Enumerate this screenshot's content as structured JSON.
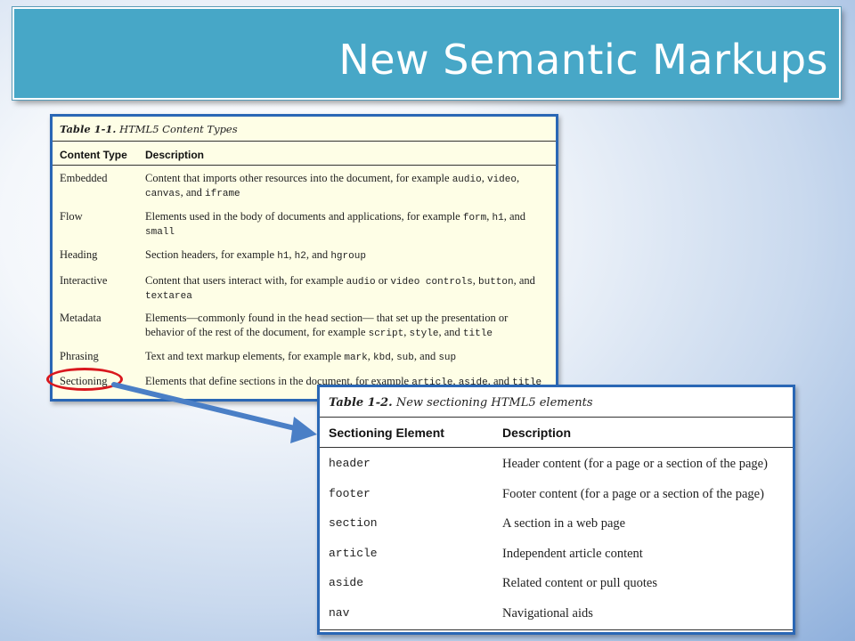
{
  "slide": {
    "title": "New Semantic Markups"
  },
  "table1": {
    "caption_label": "Table 1-1.",
    "caption_text": " HTML5 Content Types",
    "headers": [
      "Content Type",
      "Description"
    ],
    "rows": [
      {
        "type": "Embedded",
        "desc": [
          [
            "t",
            "Content that imports other resources into the document, for example "
          ],
          [
            "m",
            "audio"
          ],
          [
            "t",
            ", "
          ],
          [
            "m",
            "video"
          ],
          [
            "t",
            ",\n"
          ],
          [
            "m",
            "canvas"
          ],
          [
            "t",
            ", and "
          ],
          [
            "m",
            "iframe"
          ]
        ]
      },
      {
        "type": "Flow",
        "desc": [
          [
            "t",
            "Elements used in the body of documents and applications, for example "
          ],
          [
            "m",
            "form"
          ],
          [
            "t",
            ", "
          ],
          [
            "m",
            "h1"
          ],
          [
            "t",
            ", and\n"
          ],
          [
            "m",
            "small"
          ]
        ]
      },
      {
        "type": "Heading",
        "desc": [
          [
            "t",
            "Section headers, for example "
          ],
          [
            "m",
            "h1"
          ],
          [
            "t",
            ", "
          ],
          [
            "m",
            "h2"
          ],
          [
            "t",
            ", and "
          ],
          [
            "m",
            "hgroup"
          ]
        ]
      },
      {
        "type": "Interactive",
        "desc": [
          [
            "t",
            "Content that users interact with, for example "
          ],
          [
            "m",
            "audio"
          ],
          [
            "t",
            " or "
          ],
          [
            "m",
            "video controls"
          ],
          [
            "t",
            ", "
          ],
          [
            "m",
            "button"
          ],
          [
            "t",
            ", and\n"
          ],
          [
            "m",
            "textarea"
          ]
        ]
      },
      {
        "type": "Metadata",
        "desc": [
          [
            "t",
            "Elements—commonly found in the "
          ],
          [
            "m",
            "head"
          ],
          [
            "t",
            " section— that set up the presentation or\nbehavior of the rest of the document, for example "
          ],
          [
            "m",
            "script"
          ],
          [
            "t",
            ", "
          ],
          [
            "m",
            "style"
          ],
          [
            "t",
            ", and "
          ],
          [
            "m",
            "title"
          ]
        ]
      },
      {
        "type": "Phrasing",
        "desc": [
          [
            "t",
            "Text and text markup elements, for example "
          ],
          [
            "m",
            "mark"
          ],
          [
            "t",
            ", "
          ],
          [
            "m",
            "kbd"
          ],
          [
            "t",
            ", "
          ],
          [
            "m",
            "sub"
          ],
          [
            "t",
            ", and "
          ],
          [
            "m",
            "sup"
          ]
        ]
      },
      {
        "type": "Sectioning",
        "desc": [
          [
            "t",
            "Elements that define sections in the document, for example "
          ],
          [
            "m",
            "article"
          ],
          [
            "t",
            ", "
          ],
          [
            "m",
            "aside"
          ],
          [
            "t",
            ", and "
          ],
          [
            "m",
            "title"
          ]
        ]
      }
    ]
  },
  "table2": {
    "caption_label": "Table 1-2.",
    "caption_text": " New sectioning HTML5 elements",
    "headers": [
      "Sectioning Element",
      "Description"
    ],
    "rows": [
      {
        "element": "header",
        "desc": "Header content (for a page or a section of the page)"
      },
      {
        "element": "footer",
        "desc": "Footer content (for a page or a section of the page)"
      },
      {
        "element": "section",
        "desc": "A section in a web page"
      },
      {
        "element": "article",
        "desc": "Independent article content"
      },
      {
        "element": "aside",
        "desc": "Related content or pull quotes"
      },
      {
        "element": "nav",
        "desc": "Navigational aids"
      }
    ]
  },
  "annotation": {
    "circle_color": "#d9181e",
    "arrow_color": "#4a7fc6"
  }
}
